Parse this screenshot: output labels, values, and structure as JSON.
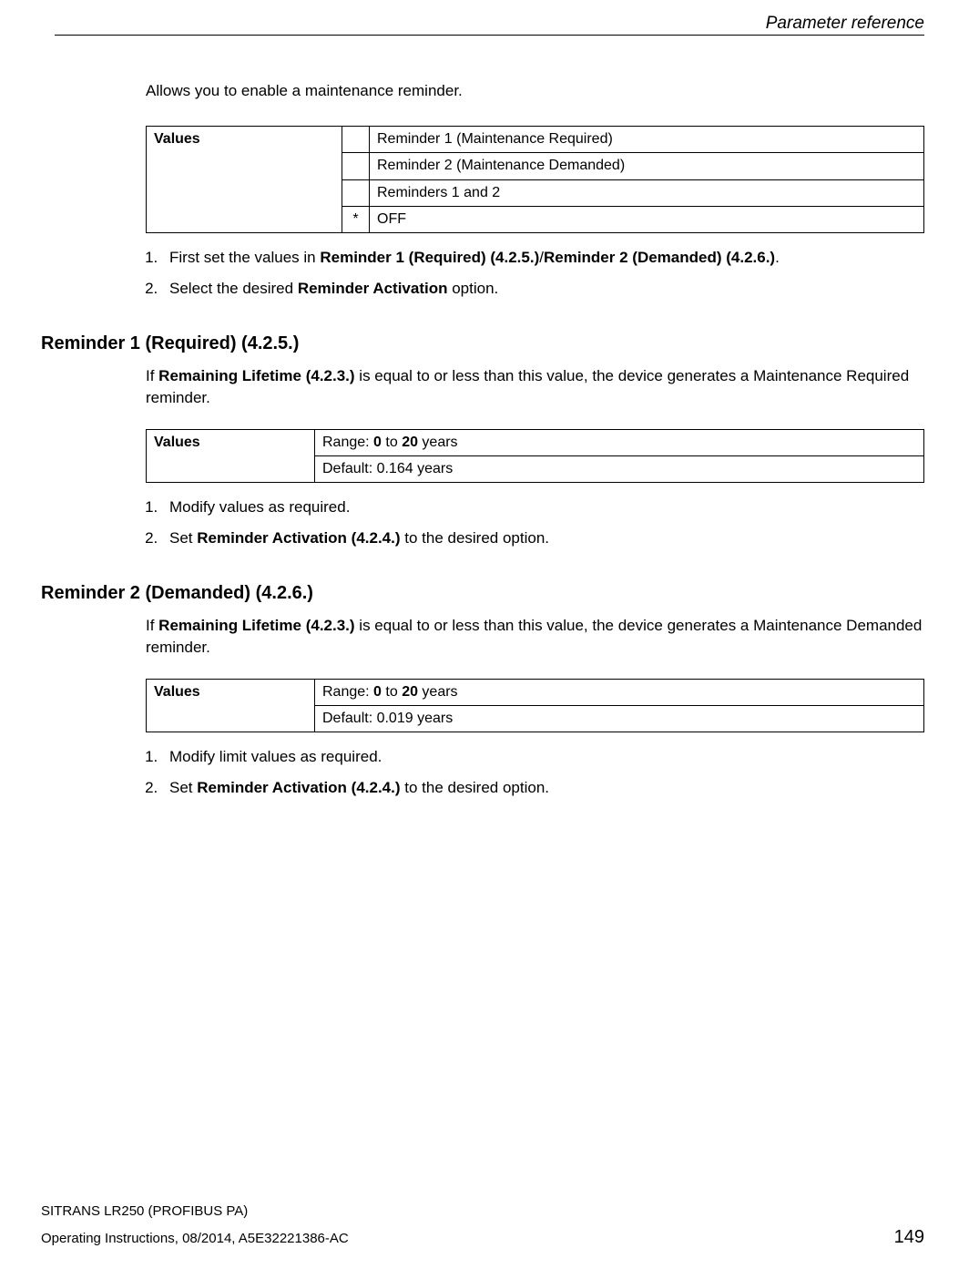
{
  "header": {
    "title": "Parameter reference"
  },
  "intro": "Allows you to enable a maintenance reminder.",
  "table1": {
    "label": "Values",
    "rows": [
      {
        "star": "",
        "text": "Reminder 1 (Maintenance Required)"
      },
      {
        "star": "",
        "text": "Reminder 2 (Maintenance Demanded)"
      },
      {
        "star": "",
        "text": "Reminders 1 and 2"
      },
      {
        "star": "*",
        "text": "OFF"
      }
    ]
  },
  "list1": {
    "item1_pre": "First set the values in ",
    "item1_b1": "Reminder 1 (Required) (4.2.5.)",
    "item1_sep": "/",
    "item1_b2": "Reminder 2 (Demanded) (4.2.6.)",
    "item1_post": ".",
    "item2_pre": "Select the desired ",
    "item2_b": "Reminder Activation",
    "item2_post": " option."
  },
  "sec1": {
    "heading": "Reminder 1 (Required) (4.2.5.)",
    "desc_pre": "If ",
    "desc_b": "Remaining Lifetime (4.2.3.)",
    "desc_post": " is equal to or less than this value, the device generates a Maintenance Required reminder.",
    "table": {
      "label": "Values",
      "row1_pre": "Range: ",
      "row1_b1": "0",
      "row1_mid": " to ",
      "row1_b2": "20",
      "row1_post": " years",
      "row2": "Default: 0.164 years"
    },
    "list": {
      "item1": "Modify values as required.",
      "item2_pre": "Set ",
      "item2_b": "Reminder Activation (4.2.4.)",
      "item2_post": " to the desired option."
    }
  },
  "sec2": {
    "heading": "Reminder 2 (Demanded) (4.2.6.)",
    "desc_pre": "If ",
    "desc_b": "Remaining Lifetime (4.2.3.)",
    "desc_post": " is equal to or less than this value, the device generates a Maintenance Demanded reminder.",
    "table": {
      "label": "Values",
      "row1_pre": "Range: ",
      "row1_b1": "0",
      "row1_mid": " to ",
      "row1_b2": "20",
      "row1_post": " years",
      "row2": "Default: 0.019 years"
    },
    "list": {
      "item1": "Modify limit values as required.",
      "item2_pre": "Set ",
      "item2_b": "Reminder Activation (4.2.4.)",
      "item2_post": " to the desired option."
    }
  },
  "footer": {
    "line1": "SITRANS LR250 (PROFIBUS PA)",
    "line2": "Operating Instructions, 08/2014, A5E32221386-AC",
    "page": "149"
  }
}
